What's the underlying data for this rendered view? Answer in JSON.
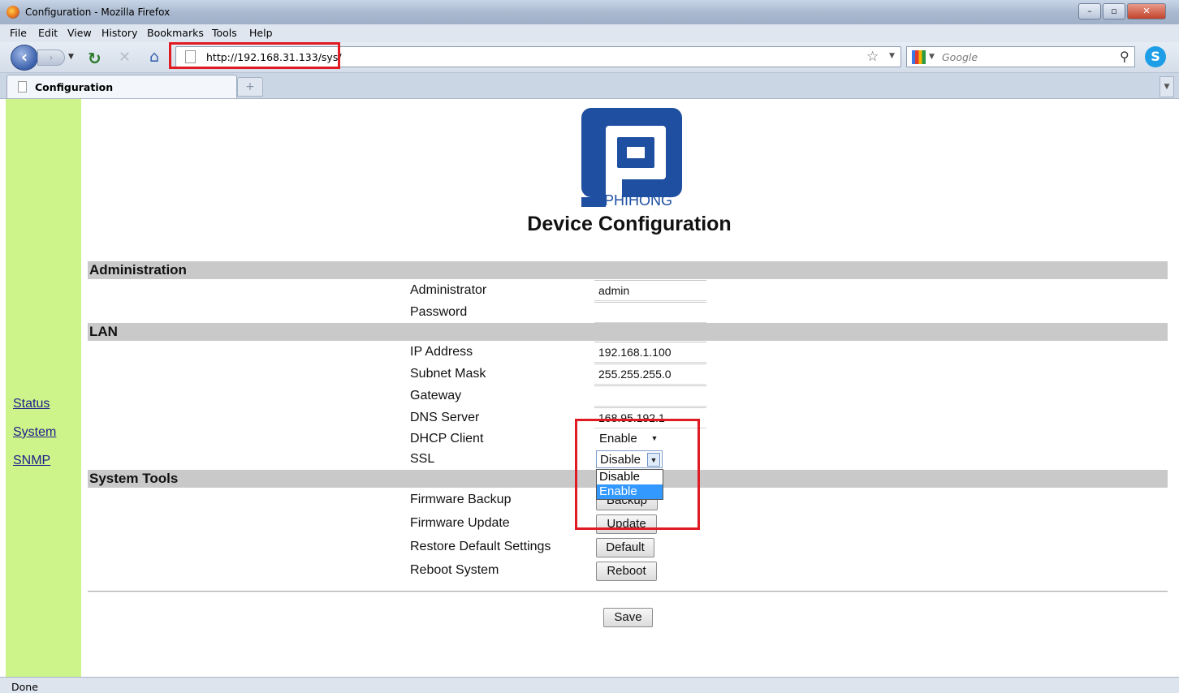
{
  "window": {
    "title": "Configuration - Mozilla Firefox"
  },
  "menu": [
    "File",
    "Edit",
    "View",
    "History",
    "Bookmarks",
    "Tools",
    "Help"
  ],
  "toolbar": {
    "url": "http://192.168.31.133/sys/",
    "search_placeholder": "Google"
  },
  "tabs": [
    {
      "label": "Configuration"
    }
  ],
  "sidebar": {
    "links": [
      "Status",
      "System",
      "SNMP"
    ]
  },
  "logo": {
    "brand": "PHIHONG",
    "color": "#1f4fa0"
  },
  "page": {
    "title": "Device Configuration"
  },
  "sections": {
    "administration": {
      "title": "Administration",
      "administrator_label": "Administrator",
      "administrator_value": "admin",
      "password_label": "Password"
    },
    "lan": {
      "title": "LAN",
      "ip_label": "IP Address",
      "ip_value": "192.168.1.100",
      "subnet_label": "Subnet Mask",
      "subnet_value": "255.255.255.0",
      "gateway_label": "Gateway",
      "dns_label": "DNS Server",
      "dns_value": "168.95.192.1",
      "dhcp_label": "DHCP Client",
      "dhcp_value": "Enable",
      "ssl_label": "SSL",
      "ssl_value": "Disable",
      "ssl_options": [
        "Disable",
        "Enable"
      ]
    },
    "system_tools": {
      "title": "System Tools",
      "backup_label": "Firmware Backup",
      "backup_button": "Backup",
      "update_label": "Firmware Update",
      "update_button": "Update",
      "restore_label": "Restore Default Settings",
      "restore_button": "Default",
      "reboot_label": "Reboot System",
      "reboot_button": "Reboot"
    }
  },
  "actions": {
    "save_button": "Save"
  },
  "status_bar": {
    "text": "Done"
  },
  "colors": {
    "sidebar_bg": "#ccf48a",
    "section_bar": "#c9c9c9",
    "annotation": "#e01b24",
    "dropdown_highlight": "#3399ff"
  }
}
